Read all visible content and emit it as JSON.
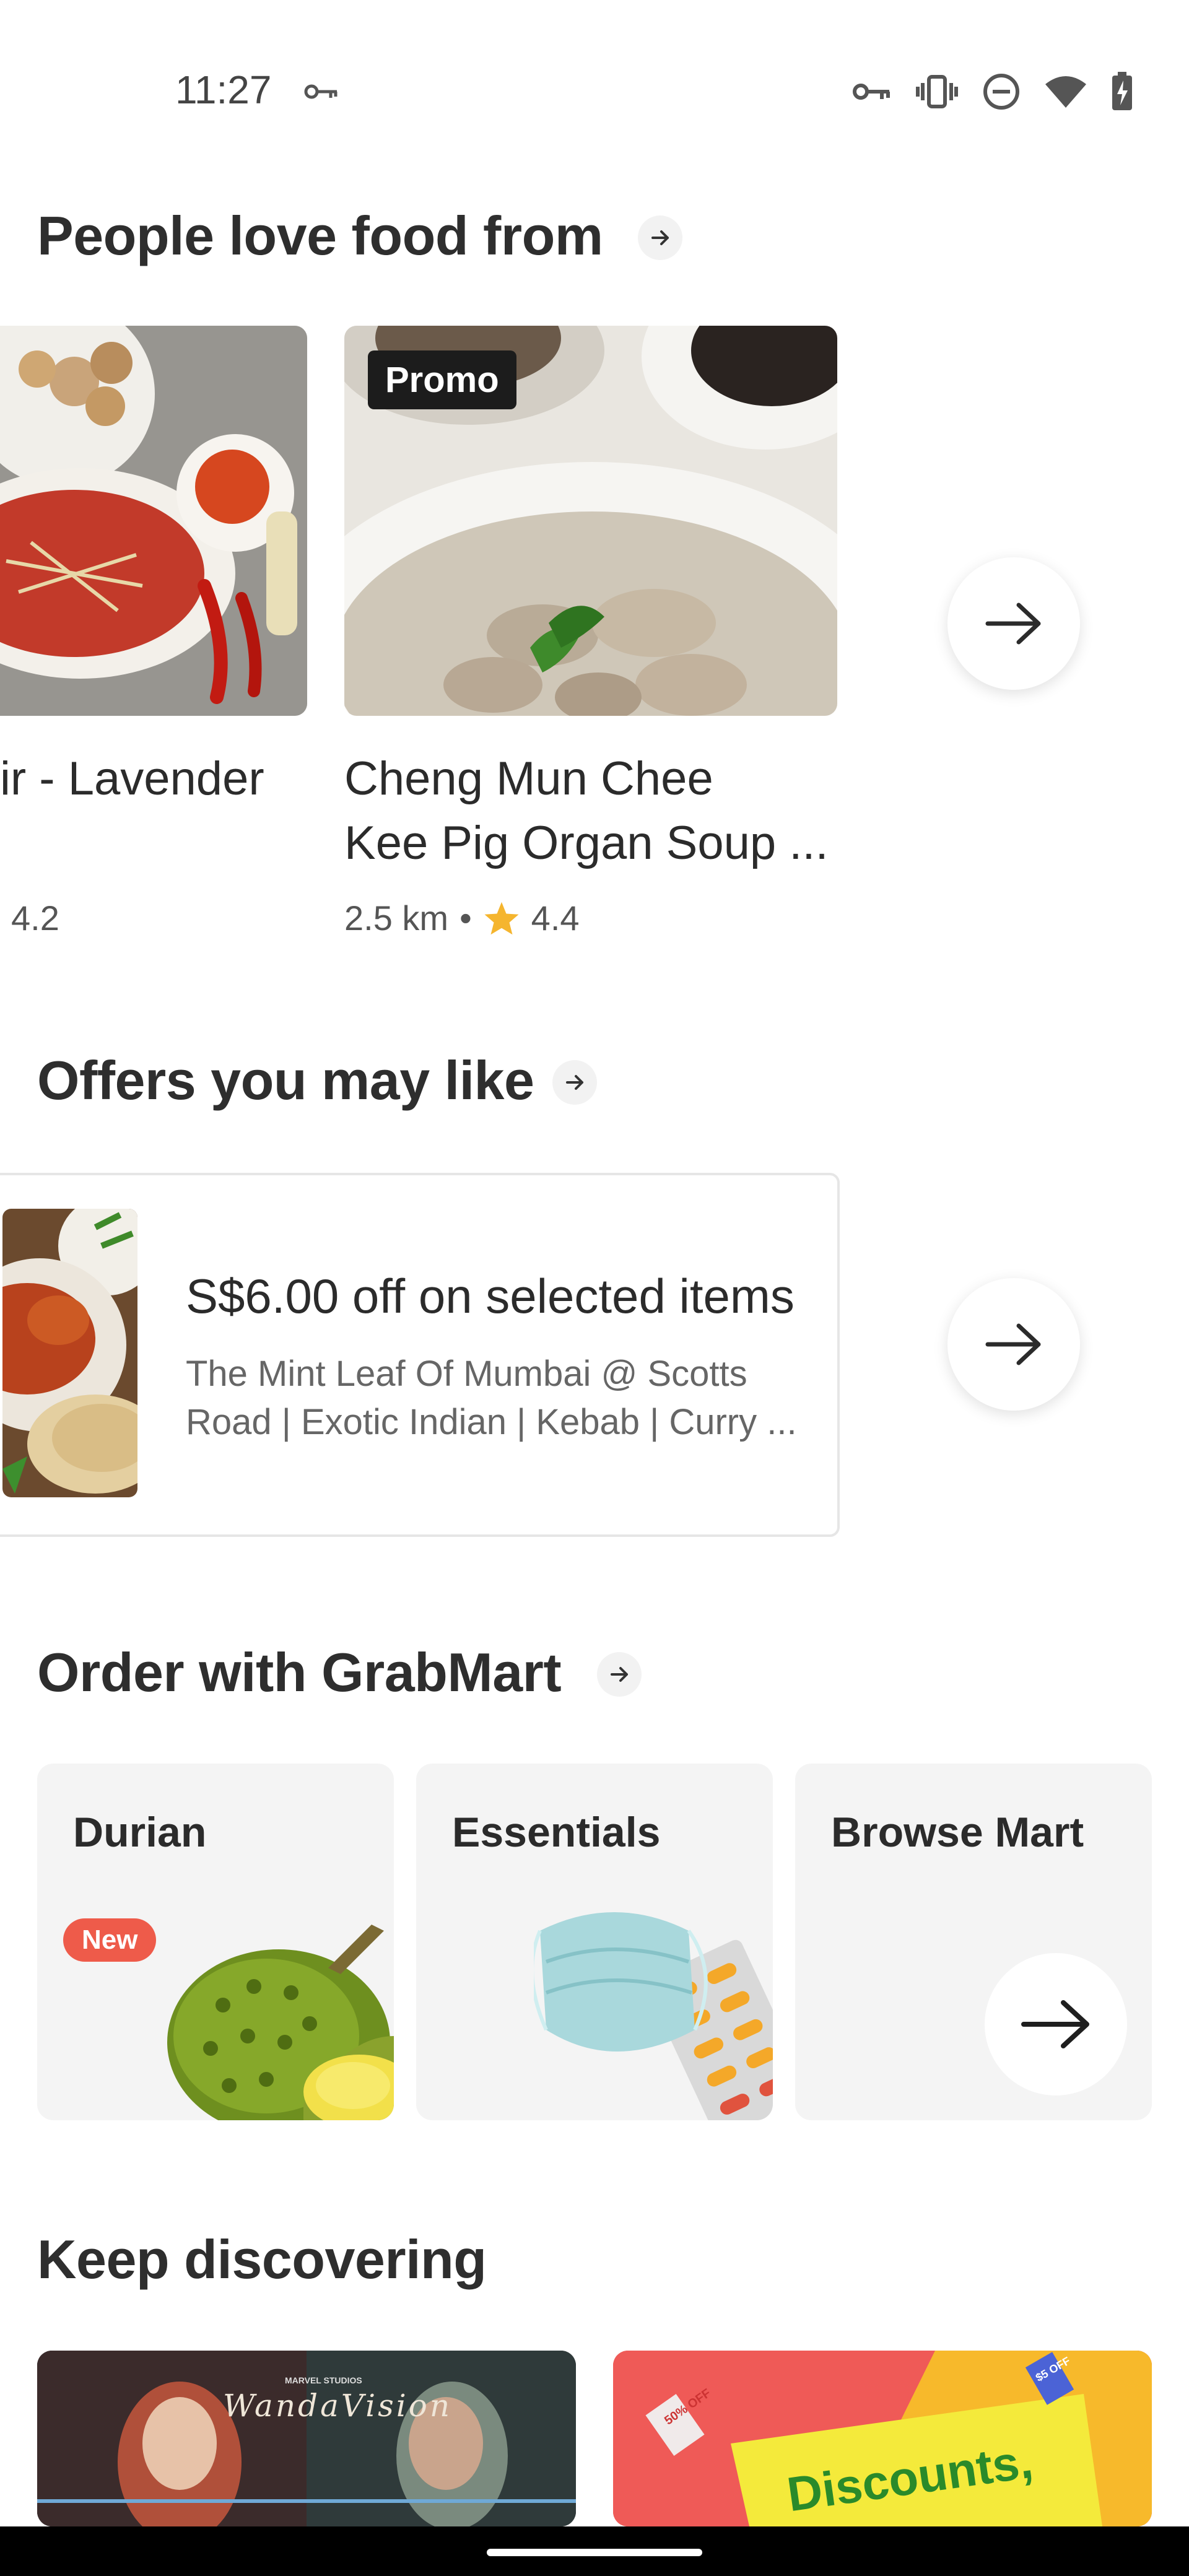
{
  "status_bar": {
    "time": "11:27",
    "icons": [
      "key-icon",
      "vibrate-icon",
      "do-not-disturb-icon",
      "wifi-icon",
      "battery-charging-icon"
    ]
  },
  "people_love": {
    "title": "People love food from",
    "cards": [
      {
        "name": "ir - Lavender",
        "rating": "4.2"
      },
      {
        "name_line1": "Cheng Mun Chee",
        "name_line2": "Kee Pig Organ Soup ...",
        "distance": "2.5 km",
        "separator": "•",
        "rating": "4.4",
        "badge": "Promo"
      }
    ]
  },
  "offers": {
    "title": "Offers you may like",
    "card": {
      "title": "S$6.00 off on selected items",
      "subtitle_line1": "The Mint Leaf Of Mumbai @ Scotts",
      "subtitle_line2": "Road | Exotic Indian | Kebab | Curry ..."
    }
  },
  "grabmart": {
    "title": "Order with GrabMart",
    "tiles": [
      {
        "label": "Durian",
        "badge": "New"
      },
      {
        "label": "Essentials"
      },
      {
        "label": "Browse Mart"
      }
    ]
  },
  "discover": {
    "title": "Keep discovering",
    "banner1_text": "WandaVision",
    "banner1_small": "MARVEL STUDIOS",
    "banner2_text": "Discounts,",
    "banner2_tag1": "50% OFF",
    "banner2_tag2": "$5 OFF"
  },
  "colors": {
    "star": "#f5b52e",
    "promo_badge": "#1c1c1c",
    "new_badge": "#ee5b4a",
    "tile_bg": "#f4f4f4"
  }
}
